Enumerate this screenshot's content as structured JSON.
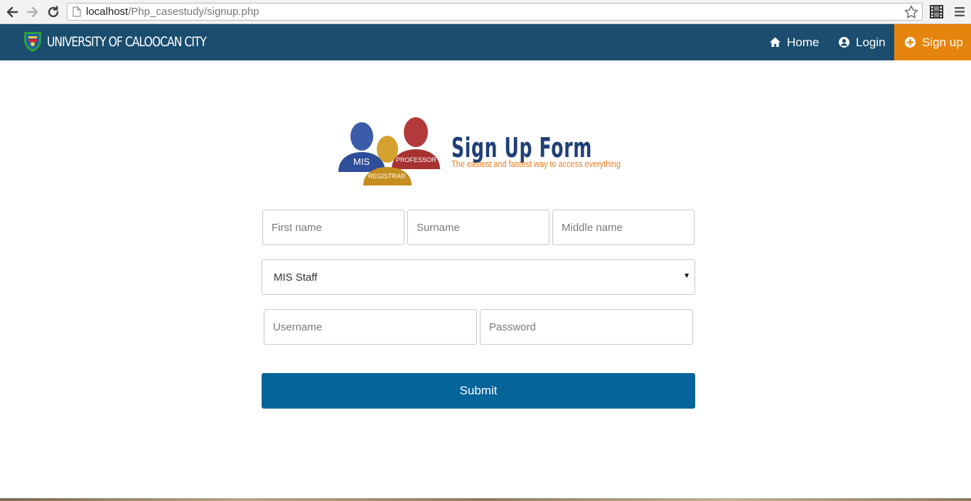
{
  "browser": {
    "url_host": "localhost",
    "url_path": "/Php_casestudy/signup.php"
  },
  "navbar": {
    "brand": "UNIVERSITY OF CALOOCAN CITY",
    "items": [
      {
        "label": "Home",
        "icon": "home-icon"
      },
      {
        "label": "Login",
        "icon": "user-circle-icon"
      },
      {
        "label": "Sign up",
        "icon": "plus-circle-icon",
        "active": true
      }
    ],
    "colors": {
      "background": "#1a4d6e",
      "active": "#e5850d"
    }
  },
  "hero": {
    "title": "Sign Up Form",
    "tagline": "The easiest and fastest way to access everything",
    "roles": [
      "MIS",
      "PROFESSOR",
      "REGISTRAR"
    ]
  },
  "form": {
    "first_name_placeholder": "First name",
    "surname_placeholder": "Surname",
    "middle_name_placeholder": "Middle name",
    "role_selected": "MIS Staff",
    "username_placeholder": "Username",
    "password_placeholder": "Password",
    "submit_label": "Submit",
    "submit_color": "#05649a"
  }
}
